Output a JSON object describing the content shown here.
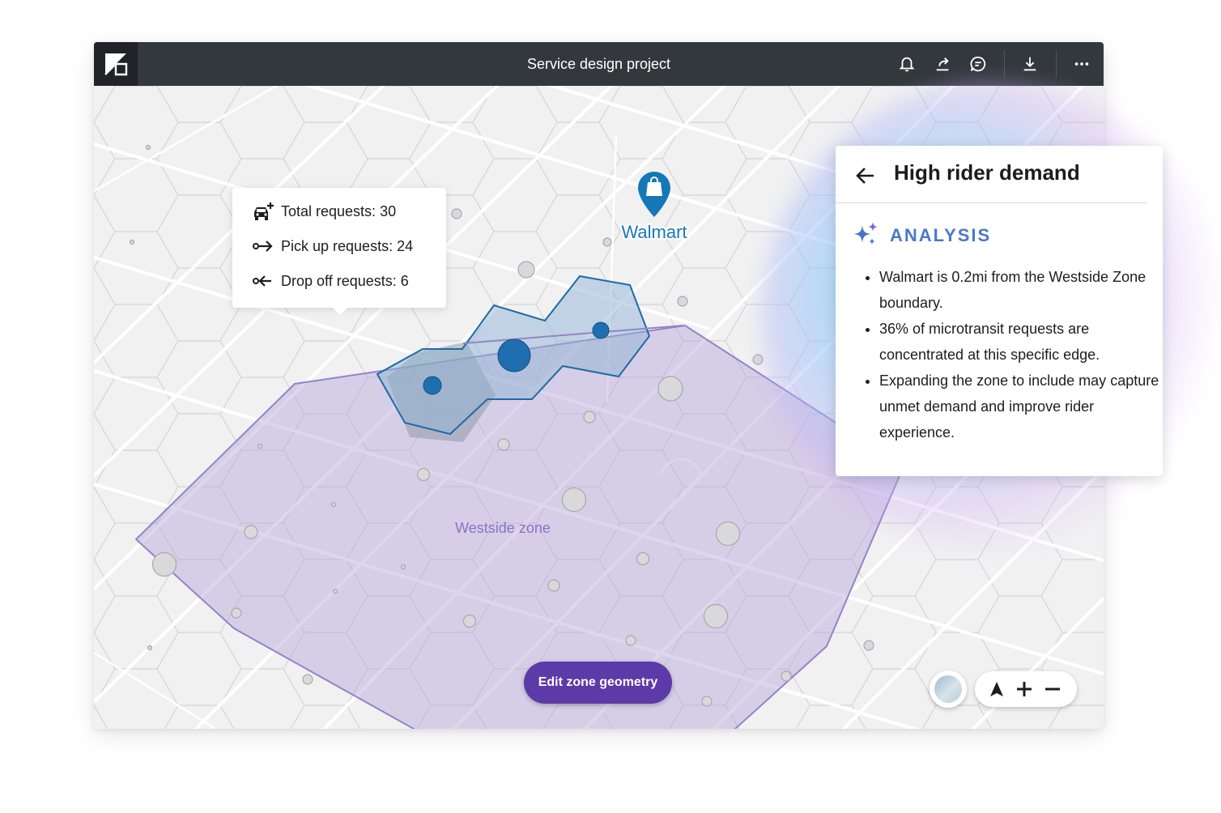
{
  "header": {
    "title": "Service design project",
    "icons": [
      "app-logo",
      "bell-icon",
      "share-icon",
      "comment-icon",
      "download-icon",
      "more-icon"
    ]
  },
  "map": {
    "poi_label": "Walmart",
    "zone_label": "Westside zone",
    "colors": {
      "zone_fill": "#b6a5d8",
      "zone_stroke": "#9583c8",
      "hotspot_fill": "#8fb3d4",
      "hotspot_stroke": "#1f6aa5",
      "poi": "#1578b6"
    }
  },
  "tooltip": {
    "total": "Total requests: 30",
    "pickup": "Pick up requests: 24",
    "dropoff": "Drop off requests: 6"
  },
  "panel": {
    "title": "High rider demand",
    "section": "ANALYSIS",
    "bullets": [
      "Walmart is 0.2mi from the Westside Zone boundary.",
      "36% of microtransit requests are concentrated at this specific edge.",
      "Expanding the zone to include may capture unmet demand and improve rider experience."
    ]
  },
  "actions": {
    "edit_zone": "Edit zone geometry"
  }
}
